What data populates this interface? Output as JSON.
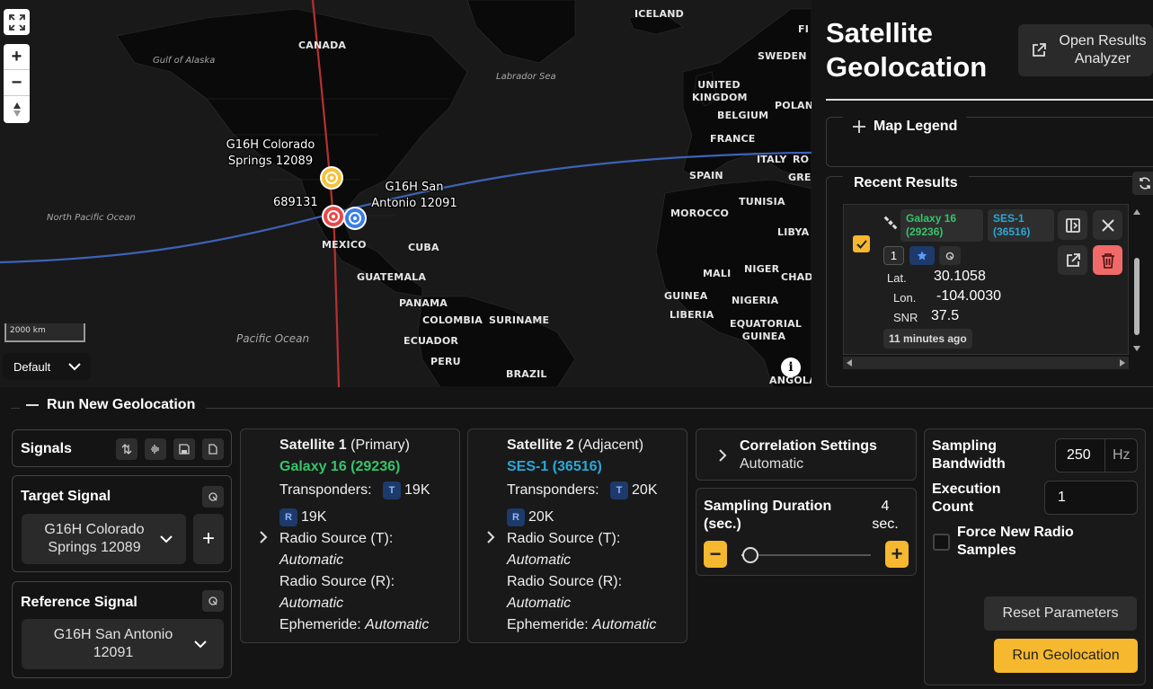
{
  "map": {
    "labels": {
      "iceland": "ICELAND",
      "canada": "CANADA",
      "sweden": "SWEDEN",
      "uk": "UNITED KINGDOM",
      "belgium": "BELGIUM",
      "poland": "POLAND",
      "france": "FRANCE",
      "italy": "ITALY",
      "spain": "SPAIN",
      "tunisia": "TUNISIA",
      "morocco": "MOROCCO",
      "libya": "LIBYA",
      "mali": "MALI",
      "niger": "NIGER",
      "chad": "CHAD",
      "guinea": "GUINEA",
      "nigeria": "NIGERIA",
      "liberia": "LIBERIA",
      "eqguinea": "EQUATORIAL GUINEA",
      "mexico": "MEXICO",
      "cuba": "CUBA",
      "guatemala": "GUATEMALA",
      "panama": "PANAMA",
      "colombia": "COLOMBIA",
      "suriname": "SURINAME",
      "ecuador": "ECUADOR",
      "peru": "PERU",
      "brazil": "BRAZIL",
      "angola": "ANGOLA",
      "fi": "FI",
      "ro": "RO",
      "gree": "GREE",
      "gulf_alaska": "Gulf of Alaska",
      "labrador": "Labrador Sea",
      "north_pacific": "North Pacific Ocean",
      "pacific": "Pacific Ocean"
    },
    "markers": {
      "colorado": "G16H Colorado Springs 12089",
      "sanantonio": "G16H San Antonio 12091",
      "result": "689131"
    },
    "scale": "2000 km",
    "basemap": "Default"
  },
  "panel": {
    "title": "Satellite Geolocation",
    "open_results": "Open Results Analyzer",
    "legend": "Map Legend",
    "recent": "Recent Results",
    "result": {
      "sat1": "Galaxy 16 (29236)",
      "sat2": "SES-1 (36516)",
      "count": "1",
      "lat_label": "Lat.",
      "lat": "30.1058",
      "lon_label": "Lon.",
      "lon": "-104.0030",
      "snr_label": "SNR",
      "snr": "37.5",
      "ago": "11 minutes ago"
    }
  },
  "run": {
    "title": "Run New Geolocation",
    "signals": "Signals",
    "target_title": "Target Signal",
    "target_value": "G16H Colorado Springs 12089",
    "reference_title": "Reference Signal",
    "reference_value": "G16H San Antonio 12091",
    "sat1": {
      "title": "Satellite 1",
      "role": "(Primary)",
      "name": "Galaxy 16 (29236)",
      "transponders": "Transponders:",
      "t": "19K",
      "r": "19K",
      "rs_t": "Radio Source (T):",
      "rs_t_val": "Automatic",
      "rs_r": "Radio Source (R):",
      "rs_r_val": "Automatic",
      "eph": "Ephemeride:",
      "eph_val": "Automatic"
    },
    "sat2": {
      "title": "Satellite 2",
      "role": "(Adjacent)",
      "name": "SES-1 (36516)",
      "transponders": "Transponders:",
      "t": "20K",
      "r": "20K",
      "rs_t": "Radio Source (T):",
      "rs_t_val": "Automatic",
      "rs_r": "Radio Source (R):",
      "rs_r_val": "Automatic",
      "eph": "Ephemeride:",
      "eph_val": "Automatic"
    },
    "tb_t": "T",
    "tb_r": "R",
    "correlation": "Correlation Settings",
    "correlation_val": "Automatic",
    "sampling_duration": "Sampling Duration (sec.)",
    "sampling_duration_val": "4 sec.",
    "sampling_duration_level": 0.07,
    "sampling_bw": "Sampling Bandwidth",
    "sampling_bw_val": "250",
    "hz": "Hz",
    "exec_count": "Execution Count",
    "exec_count_val": "1",
    "force": "Force New Radio Samples",
    "reset": "Reset Parameters",
    "run": "Run Geolocation"
  },
  "colors": {
    "accent": "#f5b82e",
    "galaxy": "#36c46a",
    "ses": "#29a8d8",
    "delete": "#f06a6a"
  }
}
